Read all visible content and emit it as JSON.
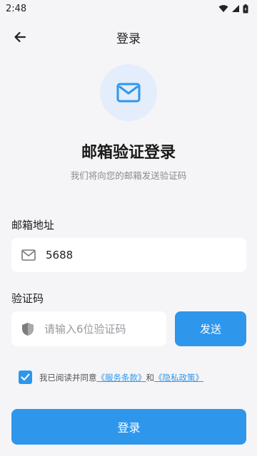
{
  "status_bar": {
    "time": "2:48"
  },
  "app_bar": {
    "title": "登录"
  },
  "header": {
    "headline": "邮箱验证登录",
    "subline": "我们将向您的邮箱发送验证码"
  },
  "email": {
    "label": "邮箱地址",
    "value": "5688"
  },
  "code": {
    "label": "验证码",
    "placeholder": "请输入6位验证码",
    "send_label": "发送"
  },
  "agreement": {
    "checked": true,
    "text": "我已阅读并同意",
    "terms_link": "《服务条款》",
    "connector": "和",
    "privacy_link": "《隐私政策》"
  },
  "login_button": {
    "label": "登录"
  },
  "colors": {
    "accent": "#2e97ec",
    "background": "#f5f5f7",
    "icon_circle": "#e3edfb"
  }
}
